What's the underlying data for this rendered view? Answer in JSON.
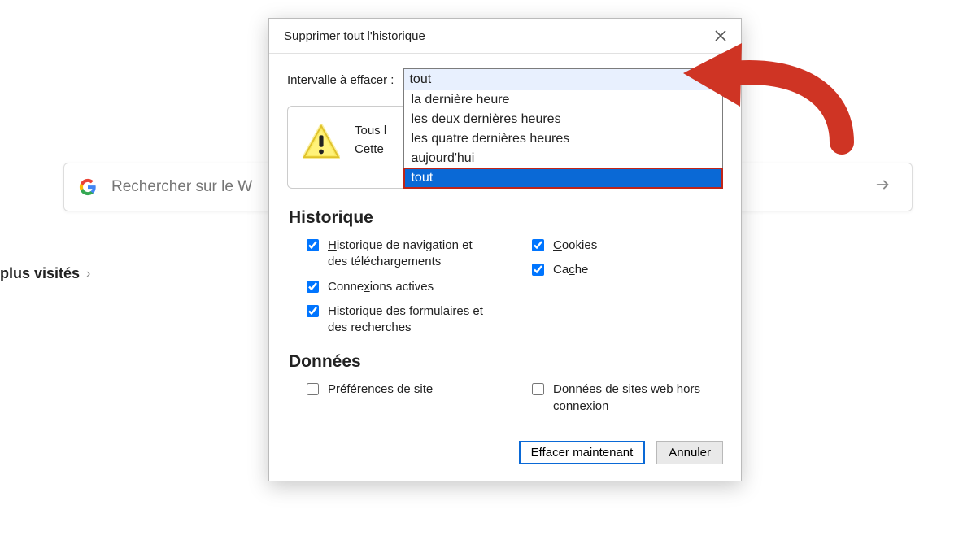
{
  "background": {
    "search_placeholder": "Rechercher sur le W",
    "most_visited": "plus visités"
  },
  "dialog": {
    "title": "Supprimer tout l'historique",
    "interval_label_pre": "I",
    "interval_label_post": "ntervalle à effacer :",
    "interval_selected": "tout",
    "interval_options": [
      "la dernière heure",
      "les deux dernières heures",
      "les quatre dernières heures",
      "aujourd'hui",
      "tout"
    ],
    "warning_line1": "Tous l",
    "warning_line2": "Cette",
    "section_history": "Historique",
    "section_data": "Données",
    "checks": {
      "nav": {
        "label_pre": "H",
        "label_post": "istorique de navigation et des téléchargements",
        "checked": true
      },
      "conn": {
        "label_pre": "Conne",
        "label_mid": "x",
        "label_post": "ions actives",
        "checked": true
      },
      "forms": {
        "label_pre": "Historique des ",
        "label_mid": "f",
        "label_post": "ormulaires et des recherches",
        "checked": true
      },
      "cookies": {
        "label_pre": "C",
        "label_post": "ookies",
        "checked": true
      },
      "cache": {
        "label_pre": "Ca",
        "label_mid": "c",
        "label_post": "he",
        "checked": true
      },
      "prefs": {
        "label_pre": "P",
        "label_post": "références de site",
        "checked": false
      },
      "offline": {
        "label_pre": "Données de sites ",
        "label_mid": "w",
        "label_post": "eb hors connexion",
        "checked": false
      }
    },
    "btn_clear": "Effacer maintenant",
    "btn_cancel": "Annuler"
  }
}
